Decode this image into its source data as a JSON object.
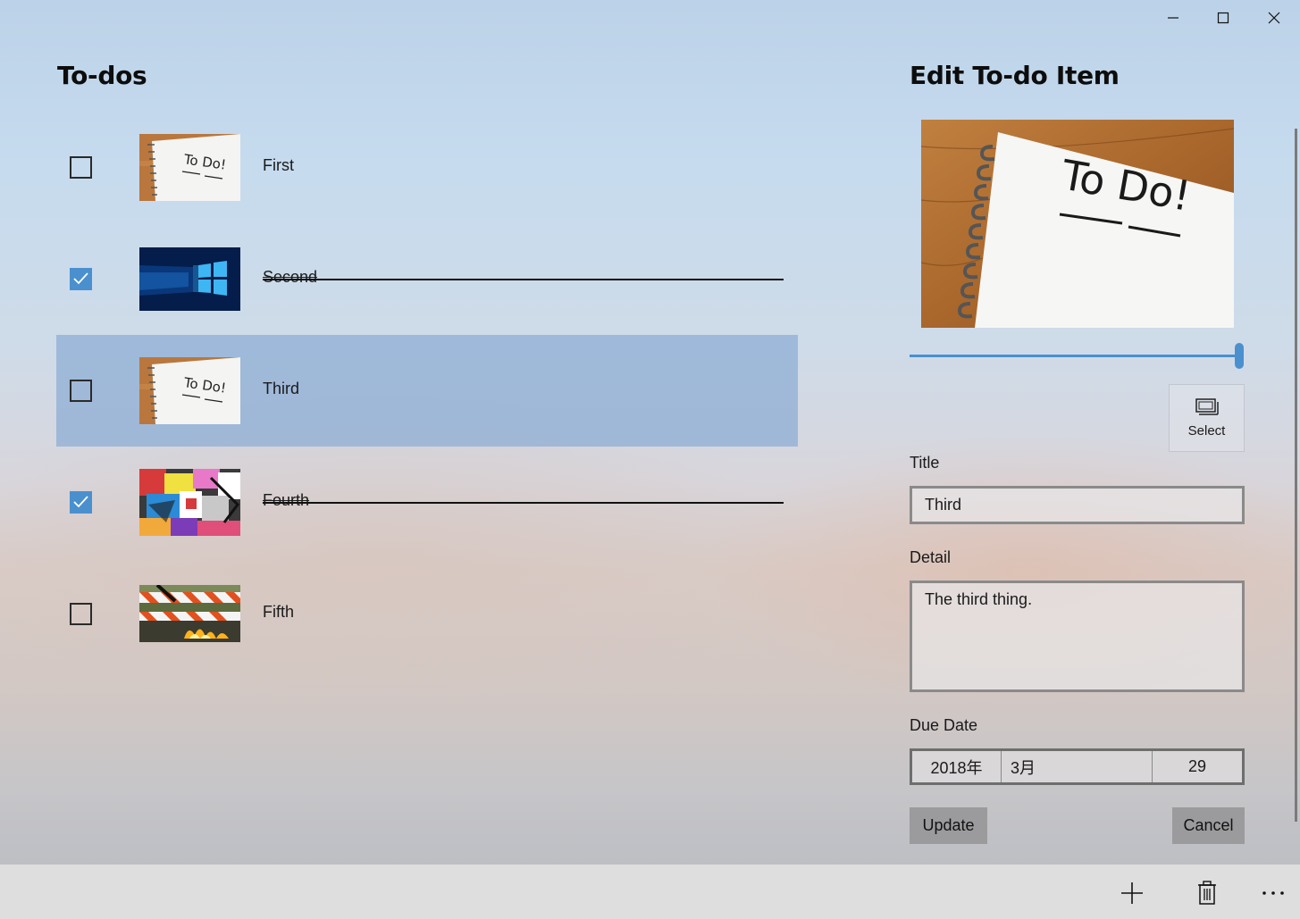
{
  "window": {
    "controls": [
      "minimize-icon",
      "maximize-icon",
      "close-icon"
    ]
  },
  "list": {
    "heading": "To-dos",
    "items": [
      {
        "label": "First",
        "checked": false,
        "image": "todo-notebook",
        "selected": false
      },
      {
        "label": "Second",
        "checked": true,
        "image": "windows-logo",
        "selected": false
      },
      {
        "label": "Third",
        "checked": false,
        "image": "todo-notebook",
        "selected": true
      },
      {
        "label": "Fourth",
        "checked": true,
        "image": "graffiti",
        "selected": false
      },
      {
        "label": "Fifth",
        "checked": false,
        "image": "construction-barrier",
        "selected": false
      }
    ]
  },
  "editor": {
    "heading": "Edit To-do Item",
    "preview_image": "todo-notebook",
    "slider_value": 1.0,
    "select_label": "Select",
    "title_label": "Title",
    "title_value": "Third",
    "detail_label": "Detail",
    "detail_value": "The third thing.",
    "due_date_label": "Due Date",
    "due_date": {
      "year": "2018年",
      "month": "3月",
      "day": "29"
    },
    "update_label": "Update",
    "cancel_label": "Cancel"
  },
  "appbar": {
    "buttons": [
      "add-icon",
      "delete-icon",
      "more-icon"
    ]
  },
  "colors": {
    "accent": "#4a90cf",
    "selection": "#8cacd4",
    "button": "#9b9b9d",
    "appbar": "#dedede"
  }
}
